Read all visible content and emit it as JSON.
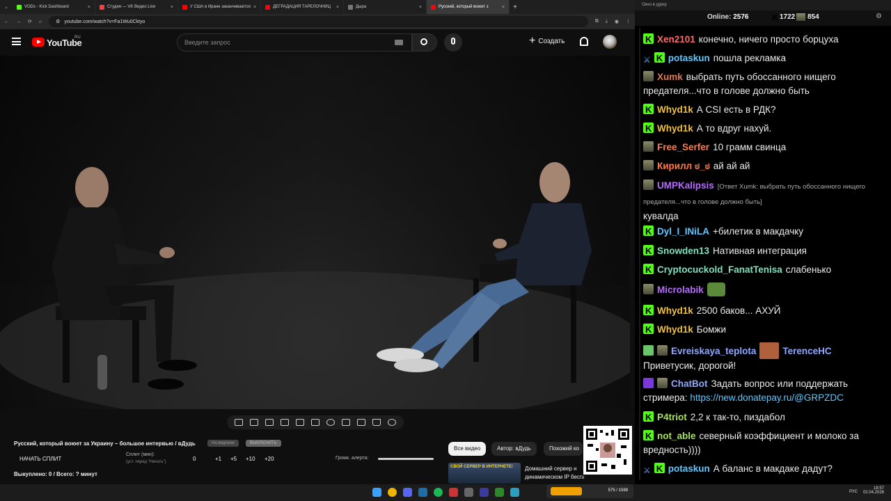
{
  "browser": {
    "tabs": [
      {
        "label": "VODs - Kick Dashboard",
        "color": "#53fc18"
      },
      {
        "label": "Студия — VK Видео Live",
        "color": "#ff3b3b"
      },
      {
        "label": "У США в Иране заканчиваются",
        "color": "#ff0000"
      },
      {
        "label": "ДЕГРАДАЦИЯ ТАРЕЛОЧНИЦ",
        "color": "#ff0000"
      },
      {
        "label": "Дырa",
        "color": "#777777"
      },
      {
        "label": "Русский, который воюет з",
        "color": "#ff0000"
      }
    ],
    "url": "youtube.com/watch?v=Fa1Wu0Cktyo"
  },
  "youtube": {
    "logo_text": "YouTube",
    "logo_region": "RU",
    "search_placeholder": "Введите запрос",
    "create_label": "Создать"
  },
  "below_video": {
    "title": "Русский, который воюет за Украину – большое интервью / вДудь",
    "pill_1": "На ведомах",
    "pill_2": "ВЫКЛЮЧИТЬ",
    "start_split": "НАЧАТЬ СПЛИТ",
    "split_label": "Сплит (мин):",
    "split_hint": "(уст. перед \"Начать\")",
    "split_values": [
      "0",
      "+1",
      "+5",
      "+10",
      "+20"
    ],
    "volume_label": "Громк. алерта:",
    "volume_level": 1.0,
    "paid_out": "Выкуплено: 0 / Всего: ? минут",
    "chips": [
      "Все видео",
      "Автор: вДудь",
      "Похожий ко"
    ],
    "rec_thumb_text": "СВОЙ СЕРВЕР В ИНТЕРНЕТЕ!",
    "rec_title_1": "Домашний сервер н",
    "rec_title_2": "динамическом IP бесплатно!..."
  },
  "chat": {
    "window_title": "Окно в дурку",
    "online_label": "Online:",
    "online_count": "2576",
    "kick_count": "1722",
    "other_count": "854",
    "messages": [
      {
        "nick": "Xen2101",
        "color": "#ff6b6b",
        "text": "конечно, ничего просто борцуха"
      },
      {
        "nick": "potaskun",
        "color": "#5ec8ff",
        "text": "пошла рекламка"
      },
      {
        "nick": "Xumk",
        "color": "#e07a55",
        "text": "выбрать путь обоссанного нищего предателя...что в голове должно быть"
      },
      {
        "nick": "Whyd1k",
        "color": "#f0c040",
        "text": "А CSI есть в РДК?"
      },
      {
        "nick": "Whyd1k",
        "color": "#f0c040",
        "text": "А то вдруг нахуй."
      },
      {
        "nick": "Free_Serfer",
        "color": "#ff7b4a",
        "text": "10 грамм свинца"
      },
      {
        "nick": "Кирилл ಠ_ಠ",
        "color": "#ff7b4a",
        "text": "ай ай ай"
      },
      {
        "nick": "UMPKalipsis",
        "color": "#b76bff",
        "reply": "[Ответ Xumk: выбрать путь обоссанного нищего предателя...что в голове должно быть]",
        "text": "кувалда"
      },
      {
        "nick": "Dyl_I_INiLA",
        "color": "#5ec8ff",
        "text": "+билетик в макдачку"
      },
      {
        "nick": "Snowden13",
        "color": "#7fe0c0",
        "text": "Нативная интеграция"
      },
      {
        "nick": "Cryptocuckold_FanatTenisa",
        "color": "#7fe0c0",
        "text": "слабенько"
      },
      {
        "nick": "Microlabik",
        "color": "#b76bff",
        "text": ""
      },
      {
        "nick": "Whyd1k",
        "color": "#f0c040",
        "text": "2500 баков... АХУЙ"
      },
      {
        "nick": "Whyd1k",
        "color": "#f0c040",
        "text": "Бомжи"
      },
      {
        "nick": "Evreiskaya_teplota",
        "color": "#8fa8ff",
        "gift_to": "TerenceHC",
        "text": "Приветусик, дорогой!"
      },
      {
        "nick": "ChatBot",
        "color": "#8fa8ff",
        "text": "Задать вопрос или поддержать стримера:",
        "link": "https://new.donatepay.ru/@GRPZDC"
      },
      {
        "nick": "P4triot",
        "color": "#a8e060",
        "text": "2,2 к так-то, пиздабол"
      },
      {
        "nick": "not_able",
        "color": "#a8e060",
        "text": "северный коэффициент и молоко за вредность))))"
      },
      {
        "nick": "potaskun",
        "color": "#5ec8ff",
        "text": "А баланс в макдаке дадут?"
      }
    ]
  },
  "taskbar": {
    "lang": "РУС",
    "time": "18:57",
    "date": "02.04.2026",
    "overlay_label": "575 / 1599"
  }
}
